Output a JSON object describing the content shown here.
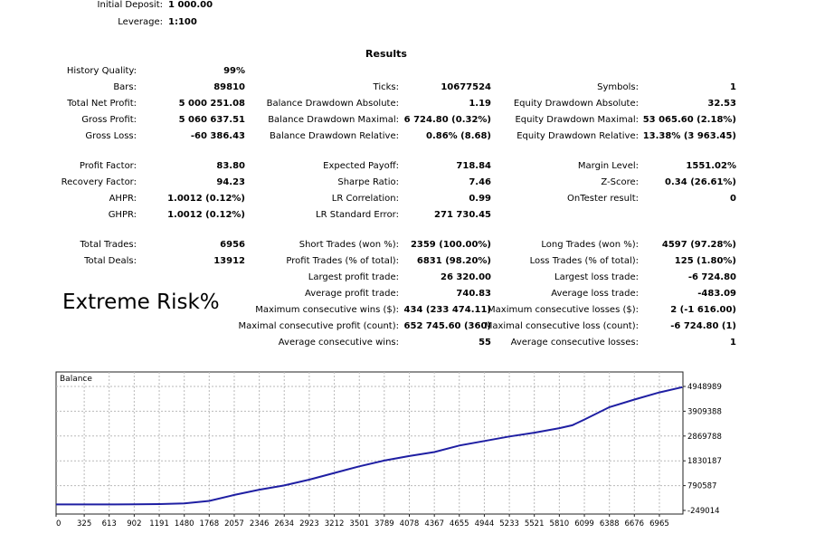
{
  "header": [
    {
      "label": "Initial Deposit:",
      "value": "1 000.00"
    },
    {
      "label": "Leverage:",
      "value": "1:100"
    }
  ],
  "results_title": "Results",
  "results": {
    "col1": [
      {
        "label": "History Quality:",
        "value": "99%"
      },
      {
        "label": "Bars:",
        "value": "89810"
      },
      {
        "label": "Total Net Profit:",
        "value": "5 000 251.08"
      },
      {
        "label": "Gross Profit:",
        "value": "5 060 637.51"
      },
      {
        "label": "Gross Loss:",
        "value": "-60 386.43"
      },
      null,
      {
        "label": "Profit Factor:",
        "value": "83.80"
      },
      {
        "label": "Recovery Factor:",
        "value": "94.23"
      },
      {
        "label": "AHPR:",
        "value": "1.0012 (0.12%)"
      },
      {
        "label": "GHPR:",
        "value": "1.0012 (0.12%)"
      },
      null,
      {
        "label": "Total Trades:",
        "value": "6956"
      },
      {
        "label": "Total Deals:",
        "value": "13912"
      }
    ],
    "col2": [
      null,
      {
        "label": "Ticks:",
        "value": "10677524"
      },
      {
        "label": "Balance Drawdown Absolute:",
        "value": "1.19"
      },
      {
        "label": "Balance Drawdown Maximal:",
        "value": "6 724.80 (0.32%)"
      },
      {
        "label": "Balance Drawdown Relative:",
        "value": "0.86% (8.68)"
      },
      null,
      {
        "label": "Expected Payoff:",
        "value": "718.84"
      },
      {
        "label": "Sharpe Ratio:",
        "value": "7.46"
      },
      {
        "label": "LR Correlation:",
        "value": "0.99"
      },
      {
        "label": "LR Standard Error:",
        "value": "271 730.45"
      },
      null,
      {
        "label": "Short Trades (won %):",
        "value": "2359 (100.00%)"
      },
      {
        "label": "Profit Trades (% of total):",
        "value": "6831 (98.20%)"
      },
      {
        "label": "Largest profit trade:",
        "value": "26 320.00"
      },
      {
        "label": "Average profit trade:",
        "value": "740.83"
      },
      {
        "label": "Maximum consecutive wins ($):",
        "value": "434 (233 474.11)"
      },
      {
        "label": "Maximal consecutive profit (count):",
        "value": "652 745.60 (360)"
      },
      {
        "label": "Average consecutive wins:",
        "value": "55"
      }
    ],
    "col3": [
      null,
      {
        "label": "Symbols:",
        "value": "1"
      },
      {
        "label": "Equity Drawdown Absolute:",
        "value": "32.53"
      },
      {
        "label": "Equity Drawdown Maximal:",
        "value": "53 065.60 (2.18%)"
      },
      {
        "label": "Equity Drawdown Relative:",
        "value": "13.38% (3 963.45)"
      },
      null,
      {
        "label": "Margin Level:",
        "value": "1551.02%"
      },
      {
        "label": "Z-Score:",
        "value": "0.34 (26.61%)"
      },
      {
        "label": "OnTester result:",
        "value": "0"
      },
      null,
      null,
      {
        "label": "Long Trades (won %):",
        "value": "4597 (97.28%)"
      },
      {
        "label": "Loss Trades (% of total):",
        "value": "125 (1.80%)"
      },
      {
        "label": "Largest loss trade:",
        "value": "-6 724.80"
      },
      {
        "label": "Average loss trade:",
        "value": "-483.09"
      },
      {
        "label": "Maximum consecutive losses ($):",
        "value": "2 (-1 616.00)"
      },
      {
        "label": "Maximal consecutive loss (count):",
        "value": "-6 724.80 (1)"
      },
      {
        "label": "Average consecutive losses:",
        "value": "1"
      }
    ]
  },
  "annotation": "Extreme Risk%",
  "chart_data": {
    "type": "line",
    "title": "Balance",
    "x_ticks": [
      "0",
      "325",
      "613",
      "902",
      "1191",
      "1480",
      "1768",
      "2057",
      "2346",
      "2634",
      "2923",
      "3212",
      "3501",
      "3789",
      "4078",
      "4367",
      "4655",
      "4944",
      "5233",
      "5521",
      "5810",
      "6099",
      "6388",
      "6676",
      "6965"
    ],
    "y_ticks": [
      "4948989",
      "3909388",
      "2869788",
      "1830187",
      "790587",
      "-249014"
    ],
    "xlim": [
      0,
      7237
    ],
    "ylim": [
      -249014,
      4948989
    ],
    "grid": true,
    "line_color": "#1f1fa3",
    "series": [
      {
        "x": [
          0,
          325,
          613,
          902,
          1191,
          1480,
          1768,
          2057,
          2346,
          2634,
          2923,
          3212,
          3501,
          3789,
          4078,
          4367,
          4655,
          4944,
          5233,
          5521,
          5810,
          5960,
          6099,
          6388,
          6676,
          6965,
          7230
        ],
        "y": [
          1000,
          1500,
          3000,
          10000,
          15000,
          45000,
          150000,
          400000,
          620000,
          800000,
          1040000,
          1320000,
          1600000,
          1840000,
          2030000,
          2200000,
          2470000,
          2660000,
          2850000,
          3010000,
          3200000,
          3320000,
          3560000,
          4080000,
          4400000,
          4700000,
          4920000
        ]
      }
    ]
  }
}
